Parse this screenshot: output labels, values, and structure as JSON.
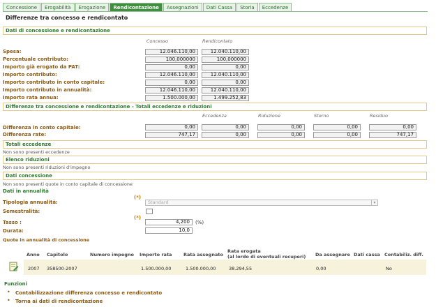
{
  "tabs": [
    "Concessione",
    "Erogabilità",
    "Erogazione",
    "Rendicontazione",
    "Assegnazioni",
    "Dati Cassa",
    "Storia",
    "Eccedenze"
  ],
  "page_title": "Differenze tra concesso e rendicontato",
  "sec1": {
    "title": "Dati di concessione e rendicontazione",
    "col_concesso": "Concesso",
    "col_rendicontato": "Rendicontato",
    "rows": [
      {
        "label": "Spesa:",
        "concesso": "12.046.110,00",
        "rendicontato": "12.040.110,00"
      },
      {
        "label": "Percentuale contributo:",
        "concesso": "100,000000",
        "rendicontato": "100,000000"
      },
      {
        "label": "Importo già erogato da PAT:",
        "concesso": "0,00",
        "rendicontato": "0,00"
      },
      {
        "label": "Importo contributo:",
        "concesso": "12.046.110,00",
        "rendicontato": "12.040.110,00"
      },
      {
        "label": "Importo contributo in conto capitale:",
        "concesso": "0,00",
        "rendicontato": "0,00"
      },
      {
        "label": "Importo contributo in annualità:",
        "concesso": "12.046.110,00",
        "rendicontato": "12.040.110,00"
      },
      {
        "label": "Importo rata annua:",
        "concesso": "1.500.000,00",
        "rendicontato": "1.499.252,83"
      }
    ]
  },
  "sec2": {
    "title": "Differenze tra concessione e rendicontazione - Totali eccedenze e riduzioni",
    "cols": [
      "Eccedenza",
      "Riduzione",
      "Storno",
      "Residuo"
    ],
    "rows": [
      {
        "label": "Differenza in conto capitale:",
        "values": [
          "0,00",
          "0,00",
          "0,00",
          "0,00",
          "0,00"
        ]
      },
      {
        "label": "Differenza rate:",
        "values": [
          "747,17",
          "0,00",
          "0,00",
          "0,00",
          "747,17"
        ]
      }
    ]
  },
  "totali": {
    "title": "Totali eccedenze",
    "note": "Non sono presenti eccedenze"
  },
  "riduzioni": {
    "title": "Elenco riduzioni",
    "note": "Non sono presenti riduzioni d'impegno"
  },
  "dati_concessione": {
    "title": "Dati concessione",
    "note": "Non sono presenti quote in conto capitale di concessione"
  },
  "annualita": {
    "heading": "Dati in annualità",
    "required_mark": "(*)",
    "tipologia_label": "Tipologia annualità:",
    "tipologia_value": "Standard",
    "semestralita_label": "Semestralità:",
    "tasso_label": "Tasso :",
    "tasso_value": "4,200",
    "tasso_unit": "(%)",
    "durata_label": "Durata:",
    "durata_value": "10,0"
  },
  "quote": {
    "heading": "Quote in annualità di concessione",
    "headers": [
      "Anno",
      "Capitolo",
      "Numero impegno",
      "Importo rata",
      "Rata assegnato",
      "Rata erogata",
      "(al lordo di eventuali recuperi)",
      "Da assegnare",
      "Dati cassa",
      "Contabiliz. diff."
    ],
    "row": {
      "anno": "2007",
      "capitolo": "358500-2007",
      "numero_impegno": "",
      "importo_rata": "1.500.000,00",
      "rata_assegnato": "1.500.000,00",
      "rata_erogata": "38.294,55",
      "da_assegnare": "0,00",
      "dati_cassa": "",
      "contabiliz": "No"
    }
  },
  "funzioni": {
    "heading": "Funzioni",
    "links": [
      "Contabilizzazione differenza concesso e rendicontato",
      "Torna ai dati di rendicontazione"
    ]
  }
}
